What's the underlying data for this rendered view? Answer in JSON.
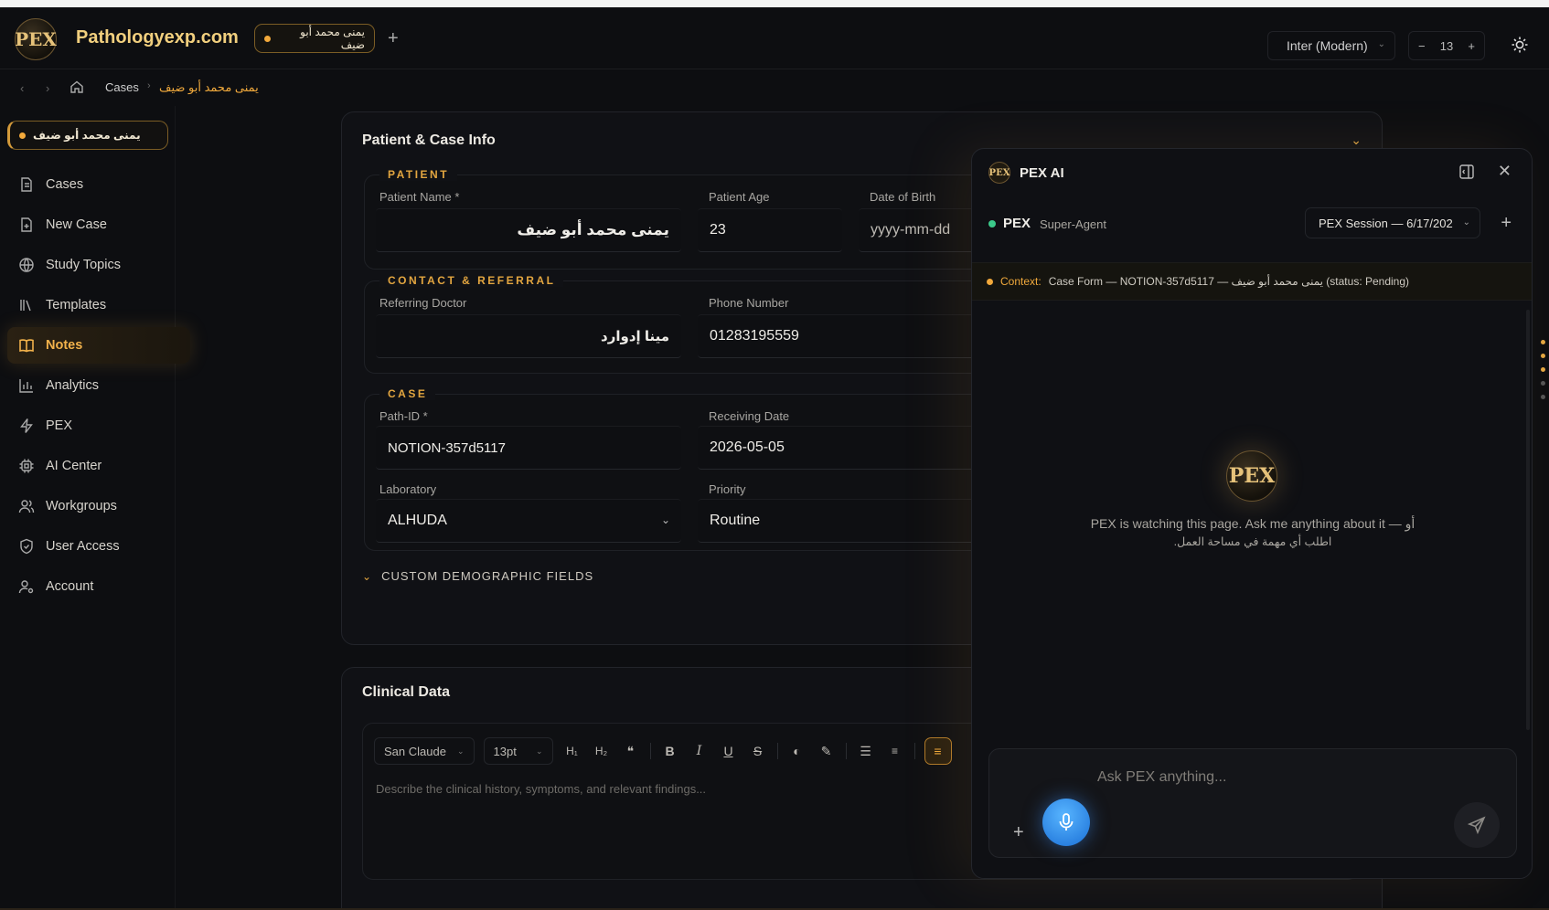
{
  "header": {
    "logo_text": "PEX",
    "brand": "Pathologyexp.com",
    "open_tab": "يمنى محمد أبو ضيف",
    "font_select": "Inter (Modern)",
    "font_size": "13"
  },
  "breadcrumb": {
    "cases": "Cases",
    "current": "يمنى محمد أبو ضيف"
  },
  "sidebar": {
    "patient_chip": "يمنى محمد أبو ضيف",
    "items": [
      {
        "label": "Cases"
      },
      {
        "label": "New Case"
      },
      {
        "label": "Study Topics"
      },
      {
        "label": "Templates"
      },
      {
        "label": "Notes"
      },
      {
        "label": "Analytics"
      },
      {
        "label": "PEX"
      },
      {
        "label": "AI Center"
      },
      {
        "label": "Workgroups"
      },
      {
        "label": "User Access"
      },
      {
        "label": "Account"
      }
    ],
    "active": "Notes"
  },
  "patient_panel": {
    "title": "Patient & Case Info",
    "patient_legend": "PATIENT",
    "patient_name_label": "Patient Name *",
    "patient_name_value": "يمنى محمد أبو ضيف",
    "patient_age_label": "Patient Age",
    "patient_age_value": "23",
    "dob_label": "Date of Birth",
    "dob_value": "yyyy-mm-dd",
    "contact_legend": "CONTACT & REFERRAL",
    "referring_label": "Referring Doctor",
    "referring_value": "مينا إدوارد",
    "phone_label": "Phone Number",
    "phone_value": "01283195559",
    "case_legend": "CASE",
    "path_id_label": "Path-ID *",
    "path_id_value": "NOTION-357d5117",
    "receiving_label": "Receiving Date",
    "receiving_value": "2026-05-05",
    "lab_label": "Laboratory",
    "lab_value": "ALHUDA",
    "priority_label": "Priority",
    "priority_value": "Routine",
    "custom_fields": "CUSTOM DEMOGRAPHIC FIELDS"
  },
  "clinical_panel": {
    "title": "Clinical Data",
    "font": "San Claude",
    "size": "13pt",
    "placeholder": "Describe the clinical history, symptoms, and relevant findings..."
  },
  "ai_panel": {
    "title": "PEX AI",
    "agent_name": "PEX",
    "agent_role": "Super-Agent",
    "session": "PEX Session — 6/17/202",
    "context_key": "Context:",
    "context_value": "Case Form — NOTION-357d5117 — يمنى محمد أبو ضيف (status: Pending)",
    "message_en": "PEX is watching this page. Ask me anything about it — أو",
    "message_ar": "اطلب أي مهمة في مساحة العمل.",
    "composer_placeholder": "Ask PEX anything..."
  },
  "colors": {
    "accent": "#f0a93c",
    "status_online": "#3bc98a",
    "mic": "#2b8df0"
  }
}
